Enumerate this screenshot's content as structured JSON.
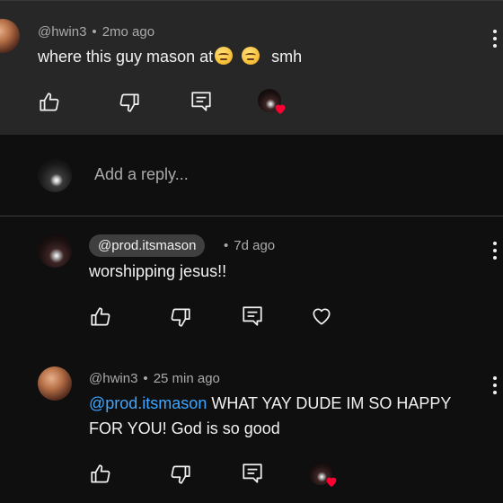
{
  "top_comment": {
    "handle": "@hwin3",
    "time": "2mo ago",
    "text": "where this guy mason at",
    "trailing": "smh",
    "emoji": [
      "unamused-face",
      "unamused-face"
    ]
  },
  "reply_bar": {
    "placeholder": "Add a reply..."
  },
  "reply1": {
    "handle": "@prod.itsmason",
    "time": "7d ago",
    "text": "worshipping jesus!!"
  },
  "reply2": {
    "handle": "@hwin3",
    "time": "25 min ago",
    "mention": "@prod.itsmason",
    "text_line1": "WHAT YAY DUDE IM SO HAPPY",
    "text_line2": "FOR YOU! God is so good"
  },
  "separator": "•",
  "colors": {
    "background": "#0f0f0f",
    "highlight_background": "#272727",
    "mention": "#3ea6ff",
    "heart": "#ff0033"
  },
  "icons": [
    "like-icon",
    "dislike-icon",
    "reply-icon",
    "heart-icon",
    "more-icon"
  ]
}
